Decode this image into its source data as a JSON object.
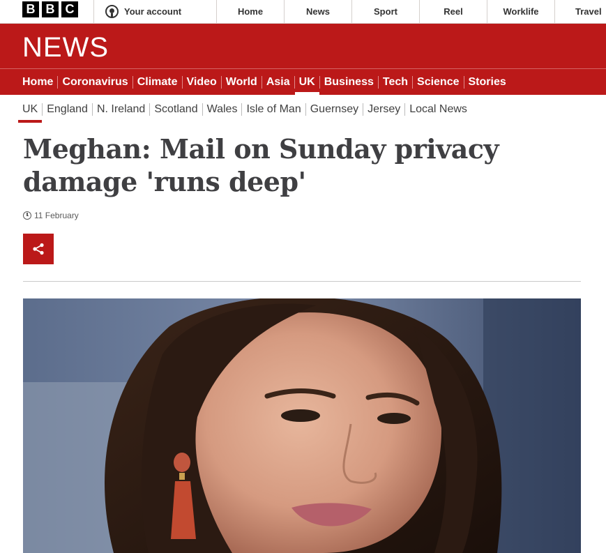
{
  "topbar": {
    "logo_letters": [
      "B",
      "B",
      "C"
    ],
    "account_label": "Your account",
    "nav": [
      "Home",
      "News",
      "Sport",
      "Reel",
      "Worklife",
      "Travel"
    ]
  },
  "news_header": {
    "logo": "NEWS",
    "nav": [
      "Home",
      "Coronavirus",
      "Climate",
      "Video",
      "World",
      "Asia",
      "UK",
      "Business",
      "Tech",
      "Science",
      "Stories"
    ],
    "active": "UK"
  },
  "subnav": {
    "items": [
      "UK",
      "England",
      "N. Ireland",
      "Scotland",
      "Wales",
      "Isle of Man",
      "Guernsey",
      "Jersey",
      "Local News"
    ],
    "active": "UK"
  },
  "article": {
    "headline": "Meghan: Mail on Sunday privacy damage 'runs deep'",
    "date": "11 February",
    "share_icon": "share-icon"
  },
  "colors": {
    "brand_red": "#bb1919",
    "text": "#3f3f42"
  }
}
